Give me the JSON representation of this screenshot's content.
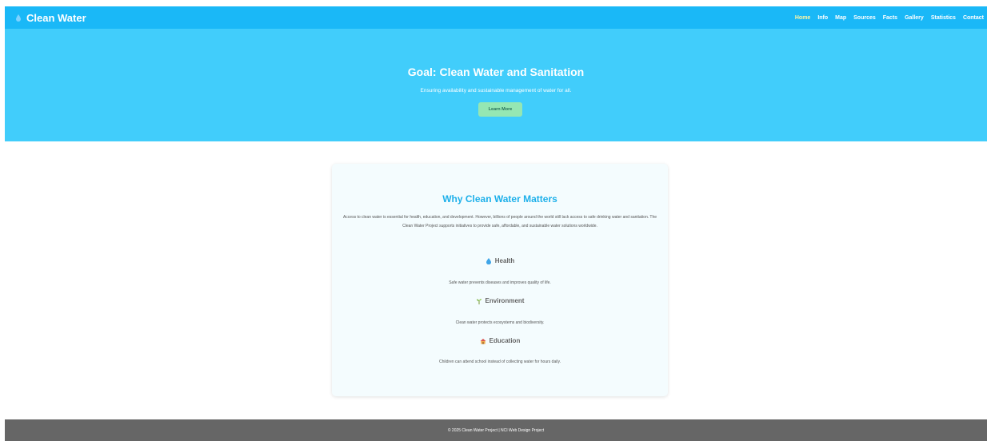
{
  "colors": {
    "navbar": "#1ab8f7",
    "hero": "#41cdfb",
    "button": "#95e7b3",
    "card_title": "#1eb0ea",
    "footer": "#666666",
    "active_link": "#fff6a3"
  },
  "navbar": {
    "brand_icon": "water-drop-icon",
    "brand": "Clean Water",
    "links": [
      {
        "label": "Home",
        "active": true
      },
      {
        "label": "Info"
      },
      {
        "label": "Map"
      },
      {
        "label": "Sources"
      },
      {
        "label": "Facts"
      },
      {
        "label": "Gallery"
      },
      {
        "label": "Statistics"
      },
      {
        "label": "Contact"
      }
    ]
  },
  "hero": {
    "title": "Goal: Clean Water and Sanitation",
    "subtitle": "Ensuring availability and sustainable management of water for all.",
    "button": "Learn More"
  },
  "card": {
    "title": "Why Clean Water Matters",
    "intro": "Access to clean water is essential for health, education, and development. However, billions of people around the world still lack access to safe drinking water and sanitation. The Clean Water Project supports initiatives to provide safe, affordable, and sustainable water solutions worldwide.",
    "features": [
      {
        "icon": "water-drop-icon",
        "title": "Health",
        "text": "Safe water prevents diseases and improves quality of life."
      },
      {
        "icon": "seedling-icon",
        "title": "Environment",
        "text": "Clean water protects ecosystems and biodiversity."
      },
      {
        "icon": "school-icon",
        "title": "Education",
        "text": "Children can attend school instead of collecting water for hours daily."
      }
    ]
  },
  "footer": {
    "text": "© 2025 Clean Water Project | NCI Web Design Project"
  }
}
